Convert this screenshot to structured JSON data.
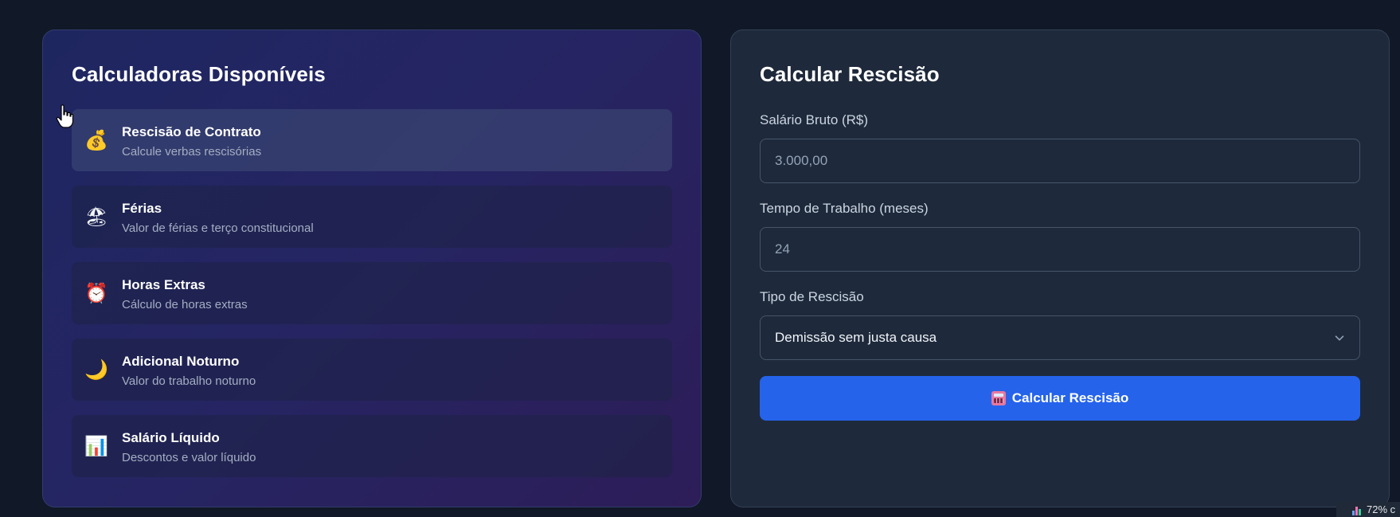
{
  "left_panel": {
    "title": "Calculadoras Disponíveis",
    "items": [
      {
        "icon": "money-bag-icon",
        "glyph": "💰",
        "title": "Rescisão de Contrato",
        "desc": "Calcule verbas rescisórias",
        "active": true
      },
      {
        "icon": "beach-umbrella-icon",
        "glyph": "🏖",
        "title": "Férias",
        "desc": "Valor de férias e terço constitucional",
        "active": false
      },
      {
        "icon": "alarm-clock-icon",
        "glyph": "⏰",
        "title": "Horas Extras",
        "desc": "Cálculo de horas extras",
        "active": false
      },
      {
        "icon": "crescent-moon-icon",
        "glyph": "🌙",
        "title": "Adicional Noturno",
        "desc": "Valor do trabalho noturno",
        "active": false
      },
      {
        "icon": "bar-chart-icon",
        "glyph": "📊",
        "title": "Salário Líquido",
        "desc": "Descontos e valor líquido",
        "active": false
      }
    ]
  },
  "right_panel": {
    "title": "Calcular Rescisão",
    "salary": {
      "label": "Salário Bruto (R$)",
      "placeholder": "3.000,00"
    },
    "months": {
      "label": "Tempo de Trabalho (meses)",
      "placeholder": "24"
    },
    "type": {
      "label": "Tipo de Rescisão",
      "value": "Demissão sem justa causa"
    },
    "submit": {
      "label": "Calcular Rescisão",
      "icon": "abacus-icon"
    }
  },
  "taskbar": {
    "zoom": "72% c"
  },
  "colors": {
    "background": "#111827",
    "panel": "#1e293b",
    "accent": "#2563eb"
  }
}
